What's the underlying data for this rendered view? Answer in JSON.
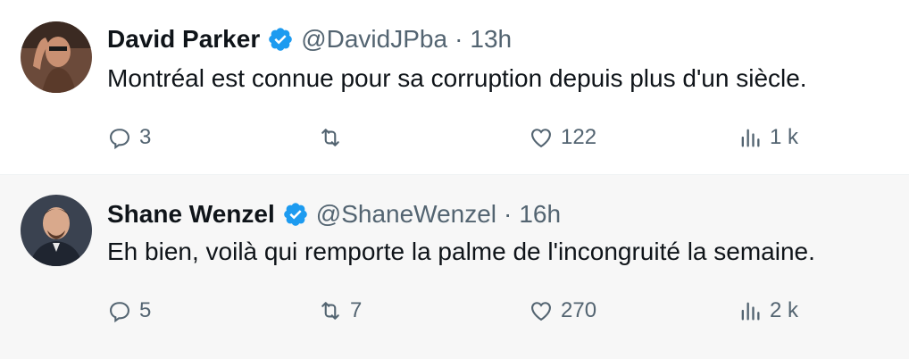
{
  "tweets": [
    {
      "author": "David Parker",
      "handle": "@DavidJPba",
      "separator": "·",
      "time": "13h",
      "text": "Montréal est connue pour sa corruption depuis plus d'un siècle.",
      "replies": "3",
      "retweets": "",
      "likes": "122",
      "views": "1 k"
    },
    {
      "author": "Shane Wenzel",
      "handle": "@ShaneWenzel",
      "separator": "·",
      "time": "16h",
      "text": "Eh bien, voilà qui remporte la palme de l'incongruité la semaine.",
      "replies": "5",
      "retweets": "7",
      "likes": "270",
      "views": "2 k"
    }
  ],
  "colors": {
    "verified": "#1d9bf0",
    "muted": "#536471",
    "text": "#0f1419"
  },
  "icons": [
    "reply-icon",
    "retweet-icon",
    "like-icon",
    "views-icon",
    "verified-badge-icon"
  ]
}
